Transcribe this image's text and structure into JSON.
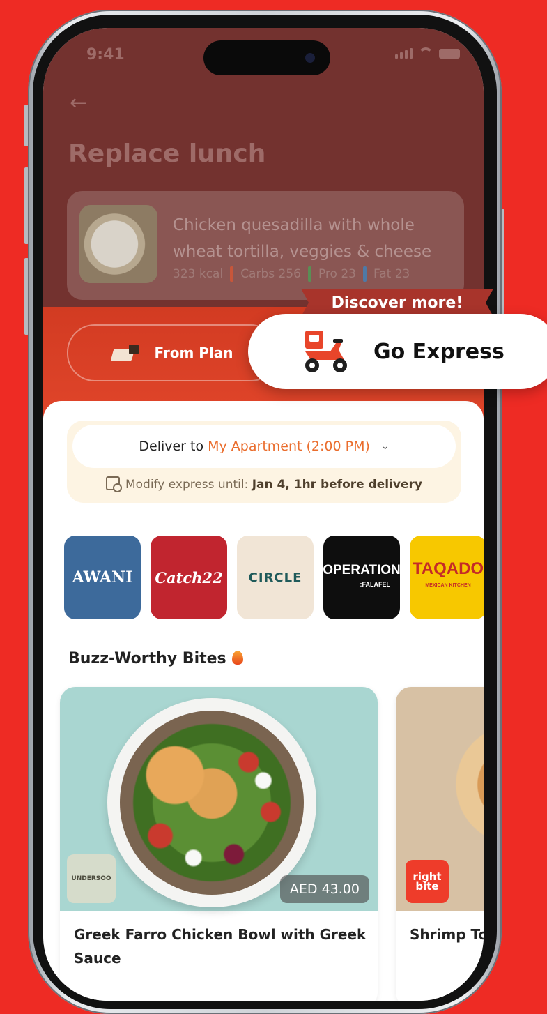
{
  "status_bar": {
    "time": "9:41"
  },
  "header": {
    "back_icon": "arrow-left-icon",
    "title": "Replace lunch"
  },
  "current_meal": {
    "name": "Chicken quesadilla with whole wheat tortilla, veggies & cheese",
    "kcal": "323 kcal",
    "carbs": "Carbs 256",
    "protein": "Pro 23",
    "fat": "Fat 23",
    "colors": {
      "carbs": "#E5532E",
      "protein": "#3DBE5A",
      "fat": "#2F8FDB"
    }
  },
  "mode_toggle": {
    "from_plan_label": "From Plan",
    "express_banner": "Discover more!",
    "express_label": "Go Express"
  },
  "delivery": {
    "prefix": "Deliver to",
    "address": "My Apartment (2:00 PM)",
    "modify_prefix": "Modify express until:",
    "modify_value": "Jan 4, 1hr before delivery"
  },
  "brands": [
    {
      "name": "AWANI"
    },
    {
      "name": "Catch22"
    },
    {
      "name": "CIRCLE"
    },
    {
      "name": "OPERATION",
      "sub": ":FALAFEL"
    },
    {
      "name": "TAQADO",
      "sub": "MEXICAN KITCHEN"
    }
  ],
  "section": {
    "title": "Buzz-Worthy Bites"
  },
  "foods": [
    {
      "title": "Greek Farro Chicken Bowl with Greek Sauce",
      "price": "AED 43.00",
      "brand_badge": "UNDERSOO"
    },
    {
      "title": "Shrimp To",
      "brand_badge": "right bite"
    }
  ],
  "theme": {
    "background": "#EE2B24",
    "accent_orange": "#EA6D2D"
  }
}
